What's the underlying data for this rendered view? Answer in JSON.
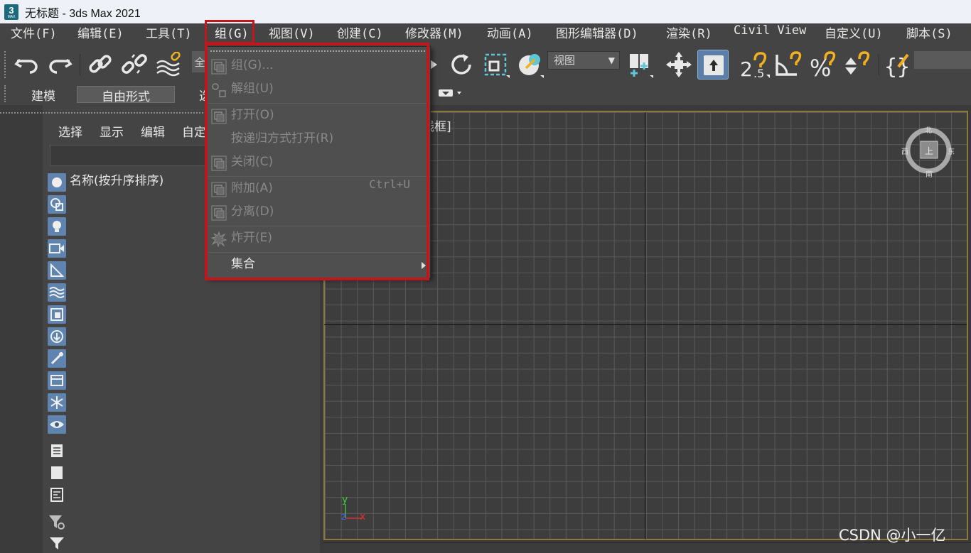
{
  "window": {
    "title": "无标题 - 3ds Max 2021",
    "app_icon_text": "3",
    "app_icon_subtext": "MAX"
  },
  "menubar": {
    "items": [
      "文件(F)",
      "编辑(E)",
      "工具(T)",
      "组(G)",
      "视图(V)",
      "创建(C)",
      "修改器(M)",
      "动画(A)",
      "图形编辑器(D)",
      "渲染(R)",
      "Civil View",
      "自定义(U)",
      "脚本(S)"
    ],
    "active": "组(G)"
  },
  "toolbar": {
    "view_select": "视图",
    "partial_left_text": "全",
    "icons": [
      "undo-icon",
      "redo-icon",
      "link-icon",
      "unlink-icon",
      "bind-space-warp-icon",
      "rotate-icon",
      "scale-icon",
      "placement-icon",
      "viewport-select",
      "use-pivot-icon",
      "move-icon",
      "select-manipulate-icon",
      "snap-2-5-icon",
      "angle-snap-icon",
      "percent-snap-icon",
      "spinner-snap-icon",
      "named-selection-icon"
    ],
    "snap_label": "2.5"
  },
  "ribbon": {
    "tabs": [
      "建模",
      "自由形式"
    ],
    "selected": "自由形式",
    "partial_tab_char": "选"
  },
  "scene_explorer": {
    "tabs": [
      "选择",
      "显示",
      "编辑",
      "自定"
    ],
    "column_header": "名称(按升序排序)",
    "filter_icons": [
      "sphere-filter-icon",
      "shape-filter-icon",
      "light-filter-icon",
      "camera-filter-icon",
      "helper-filter-icon",
      "spacewarp-filter-icon",
      "group-filter-icon",
      "xref-filter-icon",
      "bone-filter-icon",
      "container-filter-icon",
      "frozen-filter-icon",
      "hidden-filter-icon",
      "list-all-icon",
      "list-none-icon",
      "list-invert-icon",
      "filter-settings-icon",
      "filter-icon"
    ]
  },
  "viewport": {
    "label": "线框]",
    "viewcube": {
      "north": "北",
      "south": "南",
      "west": "西",
      "east": "东",
      "face": "上"
    },
    "gizmo": {
      "y": "y",
      "z": "z",
      "x": "x"
    },
    "colors": {
      "frame": "#8a7a3e",
      "grid": "#5a5a5a",
      "axis": "#111111"
    }
  },
  "group_menu": {
    "items": [
      {
        "label": "组(G)...",
        "shortcut": "",
        "enabled": false,
        "icon": "group-icon"
      },
      {
        "label": "解组(U)",
        "shortcut": "",
        "enabled": false,
        "icon": "ungroup-icon"
      },
      {
        "label": "打开(O)",
        "shortcut": "",
        "enabled": false,
        "icon": "open-group-icon"
      },
      {
        "label": "按递归方式打开(R)",
        "shortcut": "",
        "enabled": false,
        "icon": ""
      },
      {
        "label": "关闭(C)",
        "shortcut": "",
        "enabled": false,
        "icon": "close-group-icon"
      },
      {
        "label": "附加(A)",
        "shortcut": "Ctrl+U",
        "enabled": false,
        "icon": "attach-icon"
      },
      {
        "label": "分离(D)",
        "shortcut": "",
        "enabled": false,
        "icon": "detach-icon"
      },
      {
        "label": "炸开(E)",
        "shortcut": "",
        "enabled": false,
        "icon": "explode-icon"
      },
      {
        "label": "集合",
        "shortcut": "",
        "enabled": true,
        "icon": "",
        "submenu": true
      }
    ],
    "highlight_color": "#c0171c"
  },
  "watermark": "CSDN @小一亿"
}
